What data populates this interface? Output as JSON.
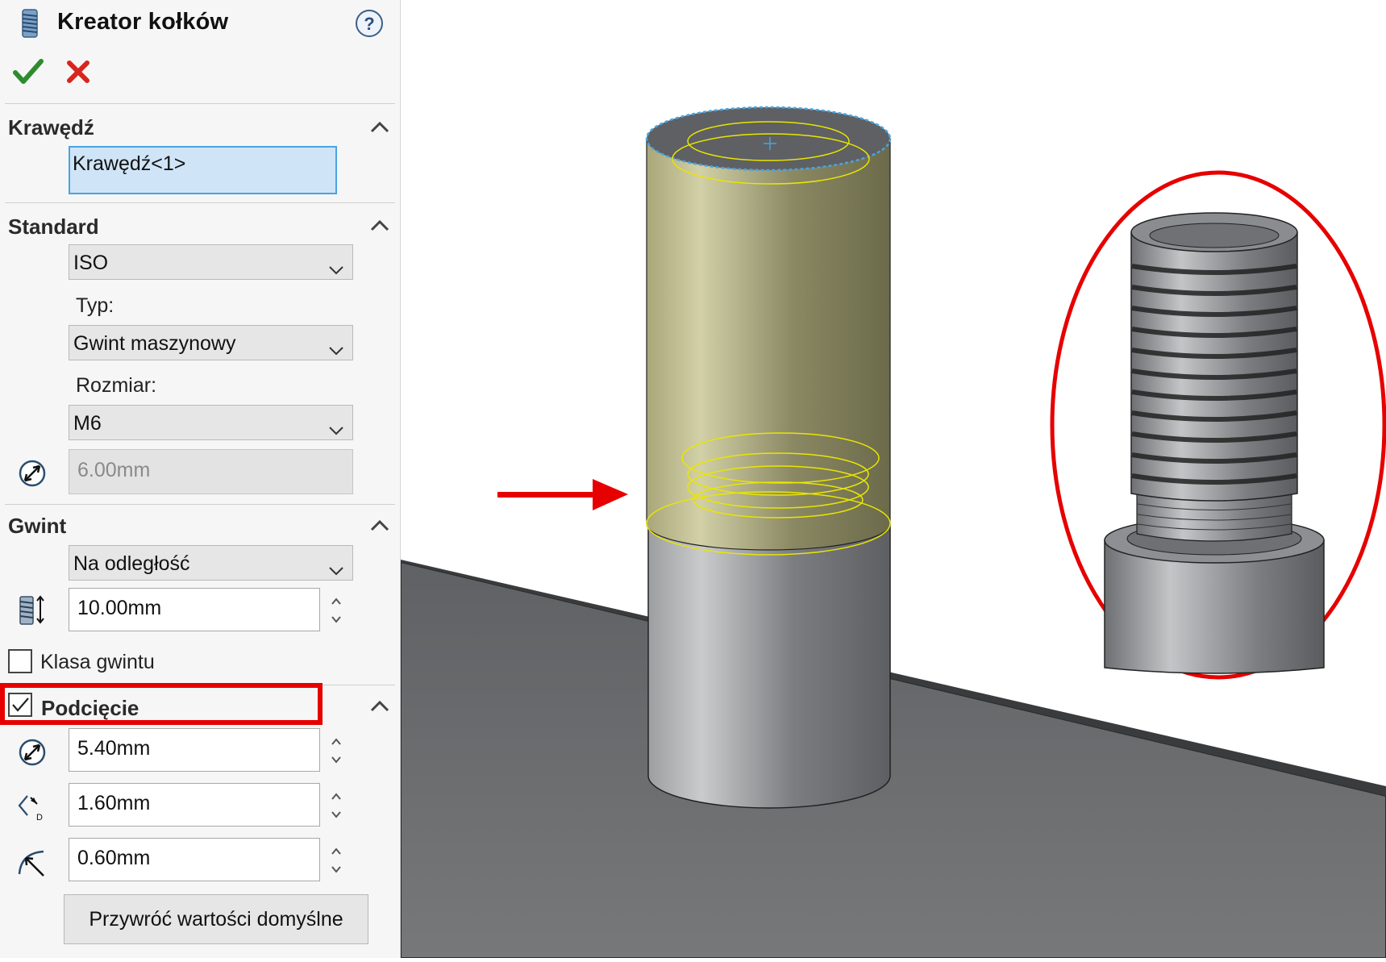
{
  "header": {
    "title": "Kreator kołków",
    "help_icon": "question-icon",
    "ok_icon": "checkmark-icon",
    "cancel_icon": "close-icon"
  },
  "sections": {
    "edge": {
      "title": "Krawędź",
      "selection_value": "Krawędź<1>"
    },
    "standard": {
      "title": "Standard",
      "standard_value": "ISO",
      "type_label": "Typ:",
      "type_value": "Gwint maszynowy",
      "size_label": "Rozmiar:",
      "size_value": "M6",
      "diameter_value": "6.00mm"
    },
    "thread": {
      "title": "Gwint",
      "end_condition_value": "Na odległość",
      "length_value": "10.00mm",
      "class_label": "Klasa gwintu",
      "class_checked": false
    },
    "undercut": {
      "title": "Podcięcie",
      "checked": true,
      "diameter_value": "5.40mm",
      "depth_value": "1.60mm",
      "radius_value": "0.60mm",
      "restore_defaults_label": "Przywróć wartości domyślne"
    }
  },
  "colors": {
    "accent_red": "#e60000",
    "selection_fill": "#cfe5f7",
    "selection_border": "#4aa3df",
    "thread_highlight": "#e8e600",
    "ok_green": "#2e8b2e"
  }
}
